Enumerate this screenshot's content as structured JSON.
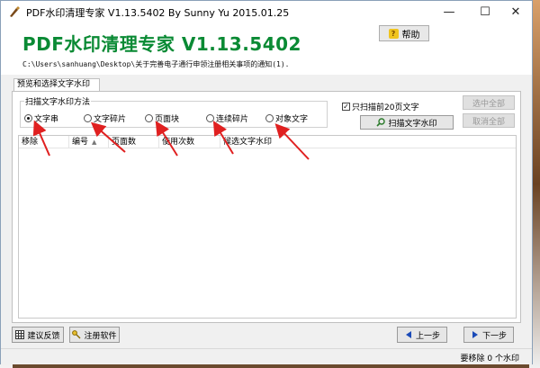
{
  "window": {
    "title": "PDF水印清理专家 V1.13.5402 By Sunny Yu 2015.01.25",
    "minimize_glyph": "—",
    "maximize_glyph": "☐",
    "close_glyph": "✕"
  },
  "banner": {
    "title": "PDF水印清理专家 V1.13.5402",
    "file_path": "C:\\Users\\sanhuang\\Desktop\\关于完善电子通行申领注册相关事项的通知(1).",
    "help_label": "帮助",
    "help_icon_glyph": "?"
  },
  "tab": {
    "label": "预览和选择文字水印"
  },
  "method": {
    "legend": "扫描文字水印方法",
    "options": [
      {
        "label": "文字串",
        "selected": true
      },
      {
        "label": "文字碎片",
        "selected": false
      },
      {
        "label": "页面块",
        "selected": false
      },
      {
        "label": "连续碎片",
        "selected": false
      },
      {
        "label": "对象文字",
        "selected": false
      }
    ]
  },
  "scan": {
    "only_first_pages_label": "只扫描前20页文字",
    "only_first_pages_checked": true,
    "scan_button_label": "扫描文字水印",
    "select_all_label": "选中全部",
    "deselect_all_label": "取消全部"
  },
  "grid": {
    "columns": [
      "移除",
      "编号",
      "页面数",
      "使用次数",
      "候选文字水印"
    ],
    "sort_glyph": "▲"
  },
  "footer": {
    "feedback_label": "建议反馈",
    "register_label": "注册软件",
    "prev_label": "上一步",
    "next_label": "下一步"
  },
  "status": {
    "text": "要移除 0 个水印"
  },
  "colors": {
    "banner_title": "#0a8a34",
    "annotation_arrow": "#e02020"
  }
}
